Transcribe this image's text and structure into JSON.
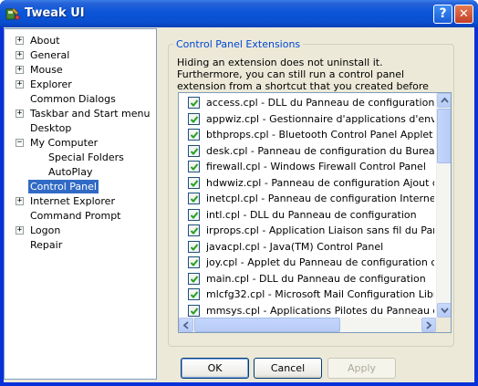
{
  "window": {
    "title": "Tweak UI",
    "help_label": "?",
    "close_label": "✕"
  },
  "tree": {
    "items": [
      {
        "label": "About",
        "expander": "+"
      },
      {
        "label": "General",
        "expander": "+"
      },
      {
        "label": "Mouse",
        "expander": "+"
      },
      {
        "label": "Explorer",
        "expander": "+"
      },
      {
        "label": "Common Dialogs",
        "expander": ""
      },
      {
        "label": "Taskbar and Start menu",
        "expander": "+"
      },
      {
        "label": "Desktop",
        "expander": ""
      },
      {
        "label": "My Computer",
        "expander": "−"
      },
      {
        "label": "Special Folders",
        "expander": ""
      },
      {
        "label": "AutoPlay",
        "expander": ""
      },
      {
        "label": "Control Panel",
        "expander": "",
        "selected": true
      },
      {
        "label": "Internet Explorer",
        "expander": "+"
      },
      {
        "label": "Command Prompt",
        "expander": ""
      },
      {
        "label": "Logon",
        "expander": "+"
      },
      {
        "label": "Repair",
        "expander": ""
      }
    ]
  },
  "panel": {
    "group_title": "Control Panel Extensions",
    "description": "Hiding an extension does not uninstall it. Furthermore, you can still run a control panel extension from a shortcut that you created before hiding it.",
    "extensions": [
      {
        "label": "access.cpl - DLL du Panneau de configuration",
        "checked": true
      },
      {
        "label": "appwiz.cpl - Gestionnaire d'applications d'environnem",
        "checked": true
      },
      {
        "label": "bthprops.cpl - Bluetooth Control Panel Applet",
        "checked": true
      },
      {
        "label": "desk.cpl - Panneau de configuration du Bureau",
        "checked": true
      },
      {
        "label": "firewall.cpl - Windows Firewall Control Panel",
        "checked": true
      },
      {
        "label": "hdwwiz.cpl - Panneau de configuration Ajout de maté",
        "checked": true
      },
      {
        "label": "inetcpl.cpl - Panneau de configuration Internet",
        "checked": true
      },
      {
        "label": "intl.cpl - DLL du Panneau de configuration",
        "checked": true
      },
      {
        "label": "irprops.cpl - Application Liaison sans fil du Panneau de",
        "checked": true
      },
      {
        "label": "javacpl.cpl - Java(TM) Control Panel",
        "checked": true
      },
      {
        "label": "joy.cpl - Applet du Panneau de configuration contrôle",
        "checked": true
      },
      {
        "label": "main.cpl - DLL du Panneau de configuration",
        "checked": true
      },
      {
        "label": "mlcfg32.cpl - Microsoft Mail Configuration Library",
        "checked": true
      },
      {
        "label": "mmsys.cpl - Applications Pilotes du Panneau de confi",
        "checked": true
      }
    ]
  },
  "buttons": {
    "ok": "OK",
    "cancel": "Cancel",
    "apply": "Apply"
  },
  "colors": {
    "title_bar": "#0a55d8",
    "selection": "#316ac5",
    "group_title": "#0046d5"
  }
}
